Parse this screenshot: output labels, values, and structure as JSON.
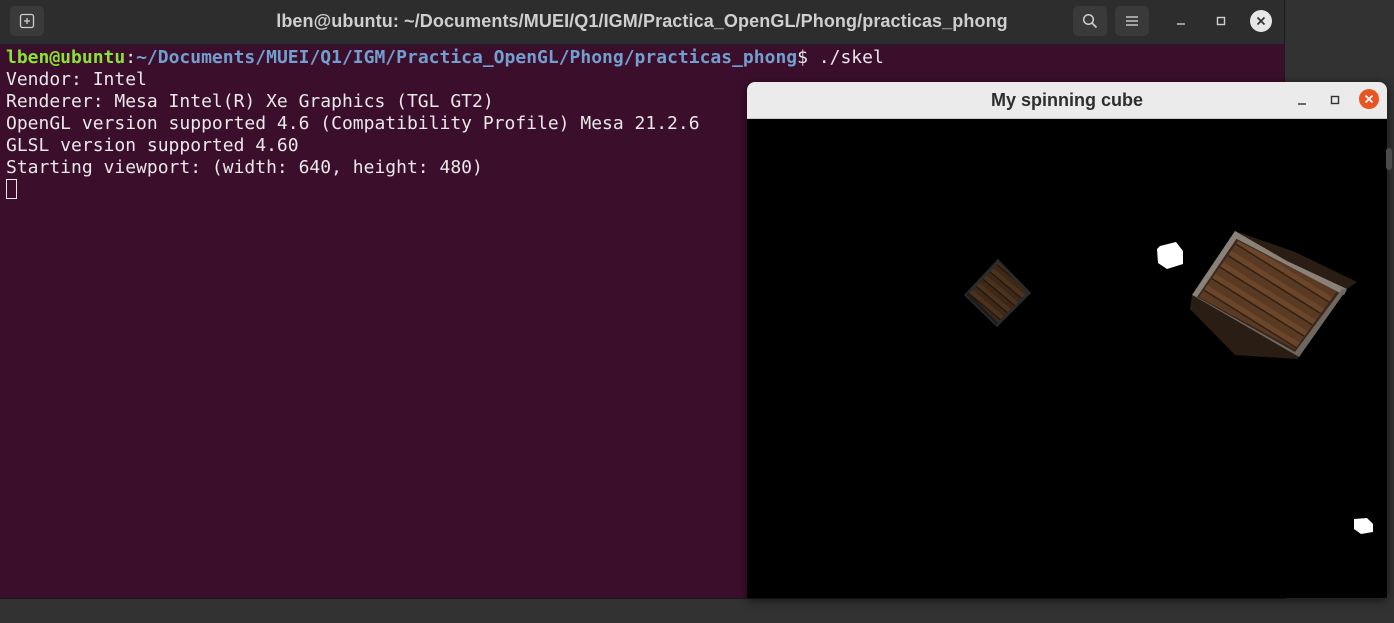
{
  "terminal": {
    "title": "lben@ubuntu: ~/Documents/MUEI/Q1/IGM/Practica_OpenGL/Phong/practicas_phong",
    "prompt_user": "lben@ubuntu",
    "prompt_sep": ":",
    "prompt_path": "~/Documents/MUEI/Q1/IGM/Practica_OpenGL/Phong/practicas_phong",
    "prompt_suffix": "$ ./skel",
    "lines": [
      "Vendor: Intel",
      "Renderer: Mesa Intel(R) Xe Graphics (TGL GT2)",
      "OpenGL version supported 4.6 (Compatibility Profile) Mesa 21.2.6",
      "GLSL version supported 4.60",
      "Starting viewport: (width: 640, height: 480)"
    ],
    "icons": {
      "new_tab": "new-tab-icon",
      "search": "search-icon",
      "menu": "hamburger-menu-icon",
      "minimize": "minimize-icon",
      "maximize": "maximize-icon",
      "close": "close-icon"
    }
  },
  "gl_window": {
    "title": "My spinning cube",
    "accent_close": "#e95420"
  },
  "colors": {
    "terminal_bg": "#3b0f2b",
    "prompt_user": "#8ae234",
    "prompt_path": "#729fcf",
    "text": "#e8e8e8"
  }
}
